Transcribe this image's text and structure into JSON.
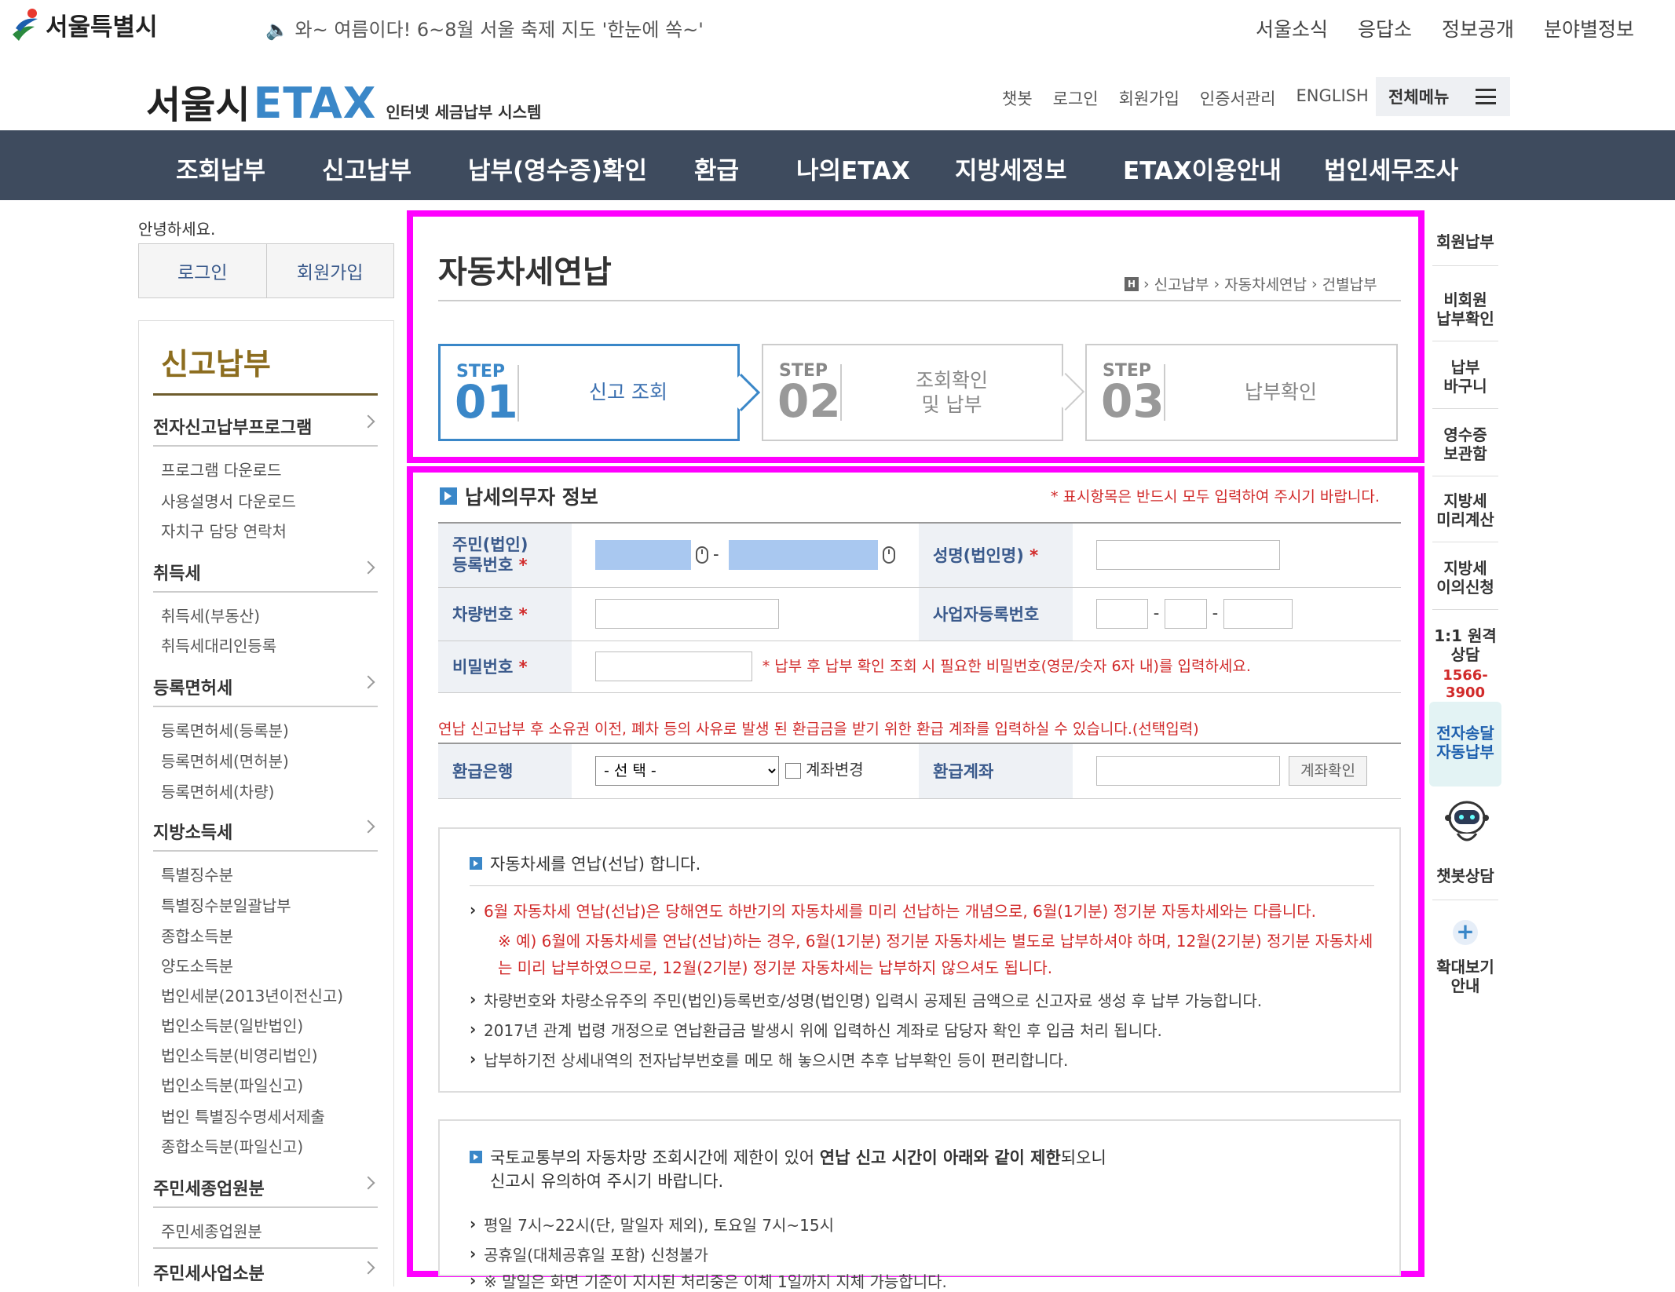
{
  "top": {
    "logo_text": "서울특별시",
    "notice": "🔈 와~ 여름이다! 6~8월 서울 축제 지도 '한눈에 쏙~'",
    "links": [
      "서울소식",
      "응답소",
      "정보공개",
      "분야별정보"
    ]
  },
  "header": {
    "logo_seoul": "서울시",
    "logo_etax": "ETAX",
    "logo_sub": "인터넷 세금납부 시스템",
    "util_links": [
      "챗봇",
      "로그인",
      "회원가입",
      "인증서관리",
      "ENGLISH"
    ],
    "all_menu": "전체메뉴"
  },
  "nav": [
    "조회납부",
    "신고납부",
    "납부(영수증)확인",
    "환급",
    "나의ETAX",
    "지방세정보",
    "ETAX이용안내",
    "법인세무조사"
  ],
  "sidebar": {
    "greeting": "안녕하세요.",
    "login": "로그인",
    "join": "회원가입",
    "title": "신고납부",
    "groups": [
      {
        "label": "전자신고납부프로그램",
        "items": [
          "프로그램 다운로드",
          "사용설명서 다운로드",
          "자치구 담당 연락처"
        ]
      },
      {
        "label": "취득세",
        "items": [
          "취득세(부동산)",
          "취득세대리인등록"
        ]
      },
      {
        "label": "등록면허세",
        "items": [
          "등록면허세(등록분)",
          "등록면허세(면허분)",
          "등록면허세(차량)"
        ]
      },
      {
        "label": "지방소득세",
        "items": [
          "특별징수분",
          "특별징수분일괄납부",
          "종합소득분",
          "양도소득분",
          "법인세분(2013년이전신고)",
          "법인소득분(일반법인)",
          "법인소득분(비영리법인)",
          "법인소득분(파일신고)",
          "법인 특별징수명세서제출",
          "종합소득분(파일신고)"
        ]
      },
      {
        "label": "주민세종업원분",
        "items": [
          "주민세종업원분"
        ]
      },
      {
        "label": "주민세사업소분",
        "items": []
      }
    ]
  },
  "page": {
    "title": "자동차세연납",
    "breadcrumb_home": "H",
    "breadcrumb": [
      "신고납부",
      "자동차세연납",
      "건별납부"
    ],
    "steps": [
      {
        "label": "STEP",
        "num": "01",
        "name": "신고 조회"
      },
      {
        "label": "STEP",
        "num": "02",
        "name": "조회확인\n및 납부"
      },
      {
        "label": "STEP",
        "num": "03",
        "name": "납부확인"
      }
    ]
  },
  "form": {
    "section_title": "납세의무자 정보",
    "required_note": "* 표시항목은 반드시 모두 입력하여 주시기 바랍니다.",
    "rrn_label": "주민(법인)\n등록번호",
    "name_label": "성명(법인명)",
    "car_label": "차량번호",
    "biz_label": "사업자등록번호",
    "pw_label": "비밀번호",
    "pw_note": "* 납부 후 납부 확인 조회 시 필요한 비밀번호(영문/숫자 6자 내)를 입력하세요.",
    "refund_note": "연납 신고납부 후 소유권 이전, 폐차 등의 사유로 발생 된 환급금을 받기 위한 환급 계좌를 입력하실 수 있습니다.(선택입력)",
    "bank_label": "환급은행",
    "bank_selected": "- 선 택 -",
    "account_change": "계좌변경",
    "account_label": "환급계좌",
    "account_check": "계좌확인",
    "required_star": "*",
    "dash": "-"
  },
  "info1": {
    "title": "자동차세를 연납(선납) 합니다.",
    "items": [
      "6월 자동차세 연납(선납)은 당해연도 하반기의 자동차세를 미리 선납하는 개념으로, 6월(1기분) 정기분 자동차세와는 다릅니다.",
      "※ 예) 6월에 자동차세를 연납(선납)하는 경우, 6월(1기분) 정기분 자동차세는 별도로 납부하셔야 하며, 12월(2기분) 정기분 자동차세",
      "는 미리 납부하였으므로, 12월(2기분) 정기분 자동차세는 납부하지 않으셔도 됩니다.",
      "차량번호와 차량소유주의 주민(법인)등록번호/성명(법인명) 입력시 공제된 금액으로 신고자료 생성 후 납부 가능합니다.",
      "2017년 관계 법령 개정으로 연납환급금 발생시 위에 입력하신 계좌로 담당자 확인 후 입금 처리 됩니다.",
      "납부하기전 상세내역의 전자납부번호를 메모 해 놓으시면 추후 납부확인 등이 편리합니다."
    ]
  },
  "info2": {
    "title_a": "국토교통부의 자동차망 조회시간에 제한이 있어 ",
    "title_b": "연납 신고 시간이 아래와 같이 제한",
    "title_c": "되오니",
    "title_d": "신고시 유의하여 주시기 바랍니다.",
    "items": [
      "평일 7시~22시(단, 말일자 제외), 토요일 7시~15시",
      "공휴일(대체공휴일 포함) 신청불가",
      "※ 말일은 화면 기준이 지시된 처리중은 이체 1일까지 지체 가능합니다."
    ]
  },
  "quick": [
    "회원납부",
    "비회원\n납부확인",
    "납부\n바구니",
    "영수증\n보관함",
    "지방세\n미리계산",
    "지방세\n이의신청",
    "1:1 원격\n상담",
    "1566-3900",
    "전자송달\n자동납부",
    "챗봇상담",
    "확대보기\n안내"
  ],
  "colors": {
    "nav_bg": "#3e4b5e",
    "accent_blue": "#3a87c8",
    "highlight_frame": "#ff00ff",
    "required_red": "#d12a2a",
    "sidebar_title": "#8c6d1f"
  }
}
